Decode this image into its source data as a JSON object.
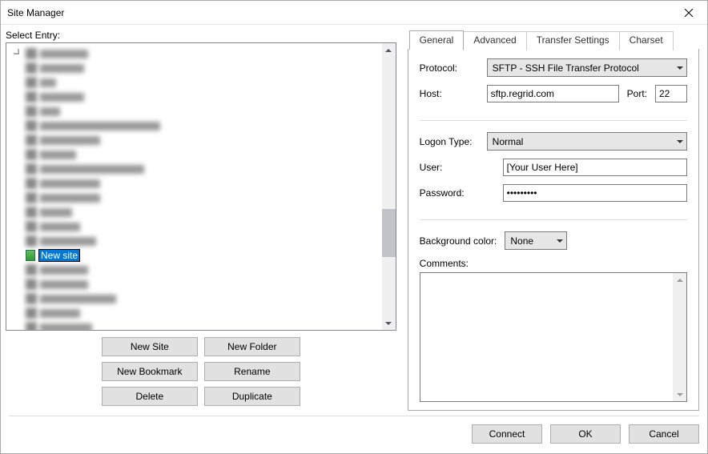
{
  "window": {
    "title": "Site Manager"
  },
  "left": {
    "label": "Select Entry:",
    "new_site_name": "New site",
    "buttons": {
      "new_site": "New Site",
      "new_folder": "New Folder",
      "new_bookmark": "New Bookmark",
      "rename": "Rename",
      "delete": "Delete",
      "duplicate": "Duplicate"
    }
  },
  "tabs": {
    "general": "General",
    "advanced": "Advanced",
    "transfer": "Transfer Settings",
    "charset": "Charset"
  },
  "general": {
    "protocol_label": "Protocol:",
    "protocol_value": "SFTP - SSH File Transfer Protocol",
    "host_label": "Host:",
    "host_value": "sftp.regrid.com",
    "port_label": "Port:",
    "port_value": "22",
    "logon_label": "Logon Type:",
    "logon_value": "Normal",
    "user_label": "User:",
    "user_value": "[Your User Here]",
    "password_label": "Password:",
    "password_value": "•••••••••",
    "bg_label": "Background color:",
    "bg_value": "None",
    "comments_label": "Comments:"
  },
  "footer": {
    "connect": "Connect",
    "ok": "OK",
    "cancel": "Cancel"
  }
}
